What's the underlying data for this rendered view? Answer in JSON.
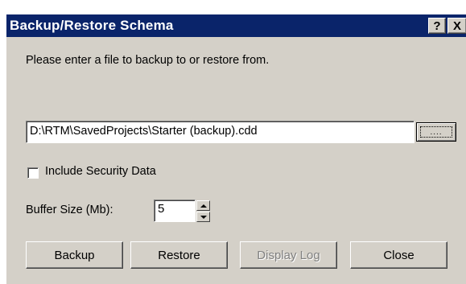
{
  "window": {
    "title": "Backup/Restore Schema",
    "help_label": "?",
    "close_label": "X"
  },
  "prompt": "Please enter a file to backup to or restore from.",
  "file_path": "D:\\RTM\\SavedProjects\\Starter (backup).cdd",
  "browse_label": "....",
  "include_security": {
    "label": "Include Security Data",
    "checked": false
  },
  "buffer": {
    "label": "Buffer Size (Mb):",
    "value": "5"
  },
  "buttons": {
    "backup": "Backup",
    "restore": "Restore",
    "display_log": "Display Log",
    "close": "Close"
  },
  "colors": {
    "titlebar": "#0a246a",
    "face": "#d4d0c8",
    "disabled_text": "#808080"
  }
}
